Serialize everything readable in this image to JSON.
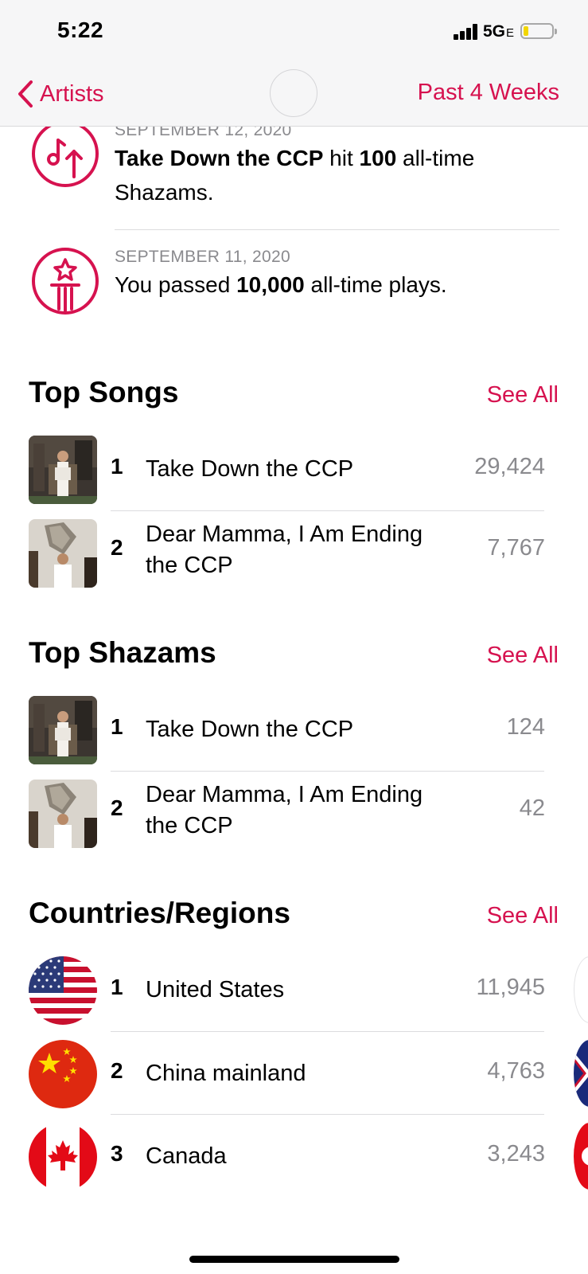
{
  "status_bar": {
    "time": "5:22",
    "network": "5G",
    "network_suffix": "E"
  },
  "nav": {
    "back_label": "Artists",
    "period_label": "Past 4 Weeks"
  },
  "milestones": [
    {
      "date": "SEPTEMBER 12, 2020",
      "text_parts": [
        "Take Down the CCP",
        " hit ",
        "100",
        " all-time Shazams."
      ],
      "icon": "shazam-up-arrow-icon"
    },
    {
      "date": "SEPTEMBER 11, 2020",
      "text_parts": [
        "You passed ",
        "10,000",
        " all-time plays."
      ],
      "icon": "star-plays-icon"
    }
  ],
  "top_songs": {
    "title": "Top Songs",
    "see_all": "See All",
    "items": [
      {
        "rank": "1",
        "title": "Take Down the CCP",
        "count": "29,424"
      },
      {
        "rank": "2",
        "title": "Dear Mamma, I Am Ending the CCP",
        "count": "7,767"
      }
    ]
  },
  "top_shazams": {
    "title": "Top Shazams",
    "see_all": "See All",
    "items": [
      {
        "rank": "1",
        "title": "Take Down the CCP",
        "count": "124"
      },
      {
        "rank": "2",
        "title": "Dear Mamma, I Am Ending the CCP",
        "count": "42"
      }
    ]
  },
  "countries": {
    "title": "Countries/Regions",
    "see_all": "See All",
    "items": [
      {
        "rank": "1",
        "name": "United States",
        "count": "11,945",
        "flag": "us-flag-icon"
      },
      {
        "rank": "2",
        "name": "China mainland",
        "count": "4,763",
        "flag": "china-flag-icon"
      },
      {
        "rank": "3",
        "name": "Canada",
        "count": "3,243",
        "flag": "canada-flag-icon"
      }
    ]
  },
  "colors": {
    "accent": "#d6124f",
    "secondary_text": "#8a8a8e"
  }
}
